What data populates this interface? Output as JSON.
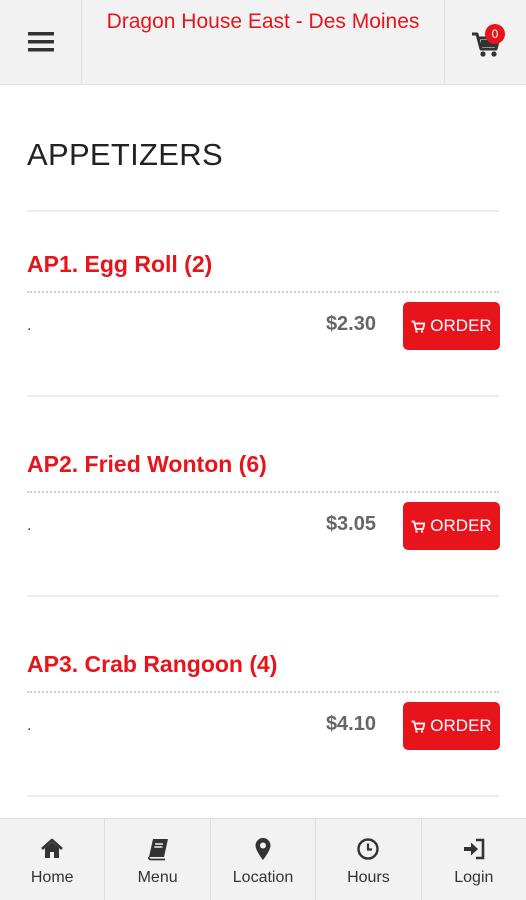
{
  "header": {
    "title": "Dragon House East - Des Moines",
    "cart_count": "0"
  },
  "section": {
    "title": "APPETIZERS"
  },
  "items": [
    {
      "name": "AP1. Egg Roll (2)",
      "description": ".",
      "price": "$2.30",
      "order_label": "ORDER"
    },
    {
      "name": "AP2. Fried Wonton (6)",
      "description": ".",
      "price": "$3.05",
      "order_label": "ORDER"
    },
    {
      "name": "AP3. Crab Rangoon (4)",
      "description": ".",
      "price": "$4.10",
      "order_label": "ORDER"
    }
  ],
  "nav": [
    {
      "label": "Home",
      "icon": "home-icon"
    },
    {
      "label": "Menu",
      "icon": "book-icon"
    },
    {
      "label": "Location",
      "icon": "map-marker-icon"
    },
    {
      "label": "Hours",
      "icon": "clock-icon"
    },
    {
      "label": "Login",
      "icon": "sign-in-icon"
    }
  ],
  "colors": {
    "accent": "#e8141c",
    "header_bg": "#f2f2f2",
    "price": "#666666"
  }
}
